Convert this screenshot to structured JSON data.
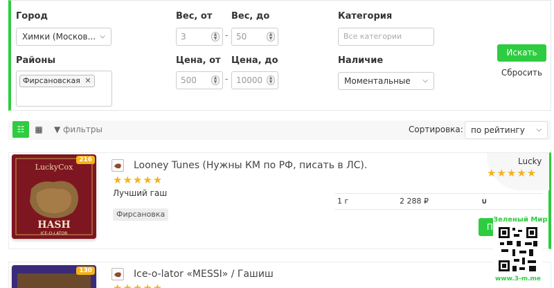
{
  "filters": {
    "city_label": "Город",
    "city_value": "Химки (Москов...",
    "districts_label": "Районы",
    "district_tag": "Фирсановская",
    "weight_from_label": "Вес, от",
    "weight_from_value": "3",
    "weight_to_label": "Вес, до",
    "weight_to_value": "50",
    "price_from_label": "Цена, от",
    "price_from_value": "500",
    "price_to_label": "Цена, до",
    "price_to_value": "10000",
    "range_sep": "-",
    "category_label": "Категория",
    "category_placeholder": "Все категории",
    "availability_label": "Наличие",
    "availability_value": "Моментальные",
    "search_button": "Искать",
    "reset_button": "Сбросить"
  },
  "toolbar": {
    "filters_link": "фильтры",
    "sort_label": "Сортировка:",
    "sort_value": "по рейтингу"
  },
  "products": [
    {
      "badge": "216",
      "image_brand": "LuckyCox",
      "image_name": "HASH",
      "image_sub": "ICE-O-LATOR",
      "title": "Looney Tunes (Нужны КМ по РФ, писать в ЛС).",
      "stars": "★★★★★",
      "description": "Лучший гаш",
      "location": "Фирсановка",
      "seller": "Lucky",
      "seller_stars": "★★★★★",
      "weight": "1 г",
      "price": "2 288 ₽",
      "buy_label": "По"
    },
    {
      "badge": "130",
      "title": "Ice-o-lator «MESSI» / Гашиш",
      "stars": "★★★★★"
    }
  ],
  "watermark": {
    "top_text": "Зеленый Мир",
    "bottom_text": "www.3-m.me"
  },
  "colors": {
    "accent_green": "#2ecc40",
    "star_yellow": "#f5b21a",
    "badge_orange": "#f5b21a"
  }
}
